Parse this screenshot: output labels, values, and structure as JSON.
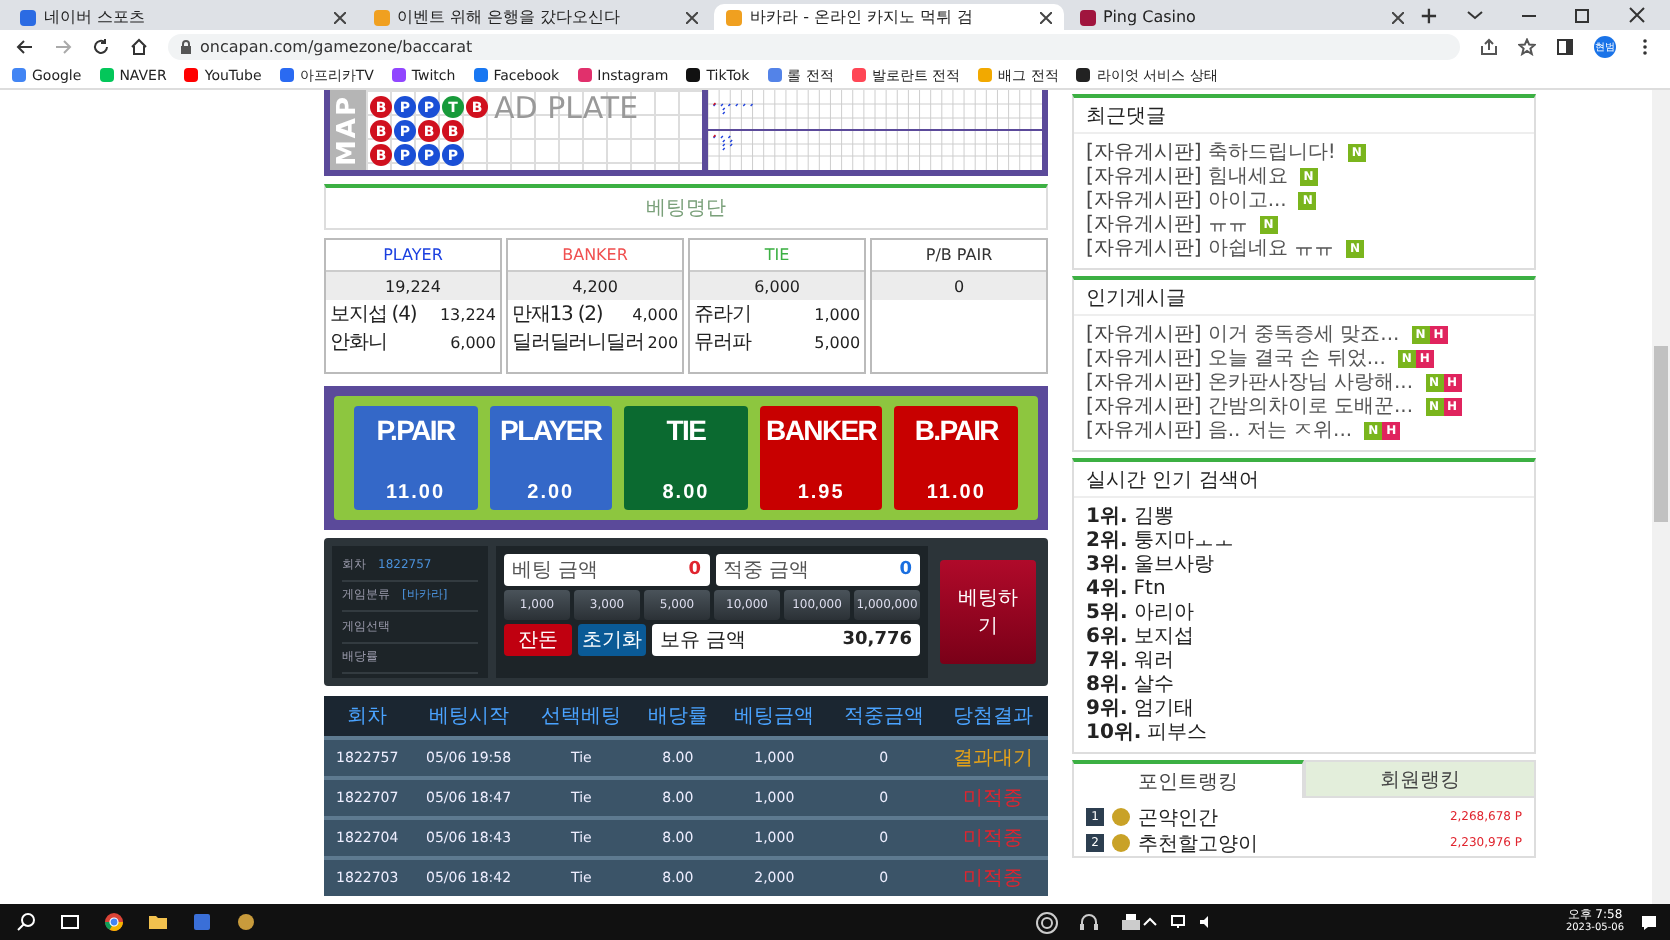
{
  "browser": {
    "tabs": [
      {
        "title": "네이버 스포츠",
        "selected": false,
        "color": "#2b6be3"
      },
      {
        "title": "이벤트 위해 은행을 갔다오신다",
        "selected": false,
        "color": "#f0a020"
      },
      {
        "title": "바카라 - 온라인 카지노 먹튀 검",
        "selected": true,
        "color": "#f0a020"
      },
      {
        "title": "Ping Casino",
        "selected": false,
        "color": "#a0153e"
      }
    ],
    "address": "oncapan.com/gamezone/baccarat",
    "profile": "현범",
    "bookmarks": [
      {
        "label": "Google",
        "color": "#4285f4"
      },
      {
        "label": "NAVER",
        "color": "#03c75a"
      },
      {
        "label": "YouTube",
        "color": "#ff0000"
      },
      {
        "label": "아프리카TV",
        "color": "#2a6af2"
      },
      {
        "label": "Twitch",
        "color": "#9146ff"
      },
      {
        "label": "Facebook",
        "color": "#1877f2"
      },
      {
        "label": "Instagram",
        "color": "#e1306c"
      },
      {
        "label": "TikTok",
        "color": "#111111"
      },
      {
        "label": "롤 전적",
        "color": "#5383e8"
      },
      {
        "label": "발로란트 전적",
        "color": "#ff4655"
      },
      {
        "label": "배그 전적",
        "color": "#f2a900"
      },
      {
        "label": "라이엇 서비스 상태",
        "color": "#222222"
      }
    ]
  },
  "road_map": {
    "label": "MAP",
    "watermark": "AD PLATE",
    "beads": [
      [
        {
          "text": "B",
          "kind": "banker"
        },
        {
          "text": "P",
          "kind": "player"
        },
        {
          "text": "P",
          "kind": "player"
        },
        {
          "text": "T",
          "kind": "tie"
        },
        {
          "text": "B",
          "kind": "banker"
        }
      ],
      [
        {
          "text": "B",
          "kind": "banker"
        },
        {
          "text": "P",
          "kind": "player"
        },
        {
          "text": "B",
          "kind": "banker"
        },
        {
          "text": "B",
          "kind": "banker"
        }
      ],
      [
        {
          "text": "B",
          "kind": "banker"
        },
        {
          "text": "P",
          "kind": "player"
        },
        {
          "text": "P",
          "kind": "player"
        },
        {
          "text": "P",
          "kind": "player"
        }
      ]
    ]
  },
  "betting_list": {
    "title": "베팅명단",
    "cards": [
      {
        "title": "PLAYER",
        "color": "#1a3fe0",
        "total": "19,224",
        "rows": [
          {
            "name": "보지섭 (4)",
            "amount": "13,224"
          },
          {
            "name": "안화니",
            "amount": "6,000"
          }
        ]
      },
      {
        "title": "BANKER",
        "color": "#f05050",
        "total": "4,200",
        "rows": [
          {
            "name": "만재13 (2)",
            "amount": "4,000"
          },
          {
            "name": "딜러딜러니딜러",
            "amount": "200"
          }
        ]
      },
      {
        "title": "TIE",
        "color": "#3cb043",
        "total": "6,000",
        "rows": [
          {
            "name": "쥬라기",
            "amount": "1,000"
          },
          {
            "name": "뮤러파",
            "amount": "5,000"
          }
        ]
      },
      {
        "title": "P/B PAIR",
        "color": "#333333",
        "total": "0"
      }
    ]
  },
  "bet_options": [
    {
      "label": "P.PAIR",
      "odds": "11.00",
      "color": "#3468c8"
    },
    {
      "label": "PLAYER",
      "odds": "2.00",
      "color": "#3468c8"
    },
    {
      "label": "TIE",
      "odds": "8.00",
      "color": "#0b6a30"
    },
    {
      "label": "BANKER",
      "odds": "1.95",
      "color": "#c80000"
    },
    {
      "label": "B.PAIR",
      "odds": "11.00",
      "color": "#c80000"
    }
  ],
  "bet_panel": {
    "info": [
      {
        "label": "회차",
        "value": "1822757"
      },
      {
        "label": "게임분류",
        "value": "[바카라]"
      },
      {
        "label": "게임선택"
      },
      {
        "label": "배당률"
      }
    ],
    "bet_amount": {
      "label": "베팅 금액",
      "value": "0"
    },
    "win_amount": {
      "label": "적중 금액",
      "value": "0"
    },
    "chips": [
      "1,000",
      "3,000",
      "5,000",
      "10,000",
      "100,000",
      "1,000,000"
    ],
    "change_button": "잔돈",
    "reset_button": "초기화",
    "balance": {
      "label": "보유 금액",
      "value": "30,776"
    },
    "submit_button": "베팅하기"
  },
  "history": {
    "columns": [
      "회차",
      "베팅시작",
      "선택베팅",
      "배당률",
      "베팅금액",
      "적중금액",
      "당첨결과"
    ],
    "rows": [
      {
        "cells": [
          "1822757",
          "05/06 19:58",
          "Tie",
          "8.00",
          "1,000",
          "0"
        ],
        "result": "결과대기",
        "kind": "waiting"
      },
      {
        "cells": [
          "1822707",
          "05/06 18:47",
          "Tie",
          "8.00",
          "1,000",
          "0"
        ],
        "result": "미적중",
        "kind": "miss"
      },
      {
        "cells": [
          "1822704",
          "05/06 18:43",
          "Tie",
          "8.00",
          "1,000",
          "0"
        ],
        "result": "미적중",
        "kind": "miss"
      },
      {
        "cells": [
          "1822703",
          "05/06 18:42",
          "Tie",
          "8.00",
          "2,000",
          "0"
        ],
        "result": "미적중",
        "kind": "miss"
      }
    ]
  },
  "sidebar": {
    "recent_comments": {
      "title": "최근댓글",
      "items": [
        {
          "board": "[자유게시판]",
          "text": "축하드립니다!",
          "badges": [
            {
              "text": "N",
              "kind": "new"
            }
          ]
        },
        {
          "board": "[자유게시판]",
          "text": "힘내세요",
          "badges": [
            {
              "text": "N",
              "kind": "new"
            }
          ]
        },
        {
          "board": "[자유게시판]",
          "text": "아이고...",
          "badges": [
            {
              "text": "N",
              "kind": "new"
            }
          ]
        },
        {
          "board": "[자유게시판]",
          "text": "ㅠㅠ",
          "badges": [
            {
              "text": "N",
              "kind": "new"
            }
          ]
        },
        {
          "board": "[자유게시판]",
          "text": "아쉽네요 ㅠㅠ",
          "badges": [
            {
              "text": "N",
              "kind": "new"
            }
          ]
        }
      ]
    },
    "popular_posts": {
      "title": "인기게시글",
      "items": [
        {
          "board": "[자유게시판]",
          "text": "이거 중독증세 맞죠...",
          "badges": [
            {
              "text": "N",
              "kind": "new"
            },
            {
              "text": "H",
              "kind": "hot"
            }
          ]
        },
        {
          "board": "[자유게시판]",
          "text": "오늘 결국 손 뒤었...",
          "badges": [
            {
              "text": "N",
              "kind": "new"
            },
            {
              "text": "H",
              "kind": "hot"
            }
          ]
        },
        {
          "board": "[자유게시판]",
          "text": "온카판사장님 사랑해...",
          "badges": [
            {
              "text": "N",
              "kind": "new"
            },
            {
              "text": "H",
              "kind": "hot"
            }
          ]
        },
        {
          "board": "[자유게시판]",
          "text": "간밤의차이로 도배꾼...",
          "badges": [
            {
              "text": "N",
              "kind": "new"
            },
            {
              "text": "H",
              "kind": "hot"
            }
          ]
        },
        {
          "board": "[자유게시판]",
          "text": "음.. 저는 ㅈ위...",
          "badges": [
            {
              "text": "N",
              "kind": "new"
            },
            {
              "text": "H",
              "kind": "hot"
            }
          ]
        }
      ]
    },
    "search_ranks": {
      "title": "실시간 인기 검색어",
      "items": [
        {
          "rank": "1위.",
          "term": "김뽕"
        },
        {
          "rank": "2위.",
          "term": "퉁지마ㅗㅗ"
        },
        {
          "rank": "3위.",
          "term": "울브사랑"
        },
        {
          "rank": "4위.",
          "term": "Ftn"
        },
        {
          "rank": "5위.",
          "term": "아리아"
        },
        {
          "rank": "6위.",
          "term": "보지섭"
        },
        {
          "rank": "7위.",
          "term": "워러"
        },
        {
          "rank": "8위.",
          "term": "살수"
        },
        {
          "rank": "9위.",
          "term": "엄기태"
        },
        {
          "rank": "10위.",
          "term": "피부스"
        }
      ]
    },
    "ranking": {
      "tabs": [
        {
          "label": "포인트랭킹",
          "selected": true
        },
        {
          "label": "회원랭킹",
          "selected": false
        }
      ],
      "entries": [
        {
          "rank": "1",
          "name": "곤약인간",
          "points": "2,268,678 P"
        },
        {
          "rank": "2",
          "name": "추천할고양이",
          "points": "2,230,976 P"
        }
      ]
    }
  },
  "taskbar": {
    "time": "오후 7:58",
    "date": "2023-05-06"
  }
}
